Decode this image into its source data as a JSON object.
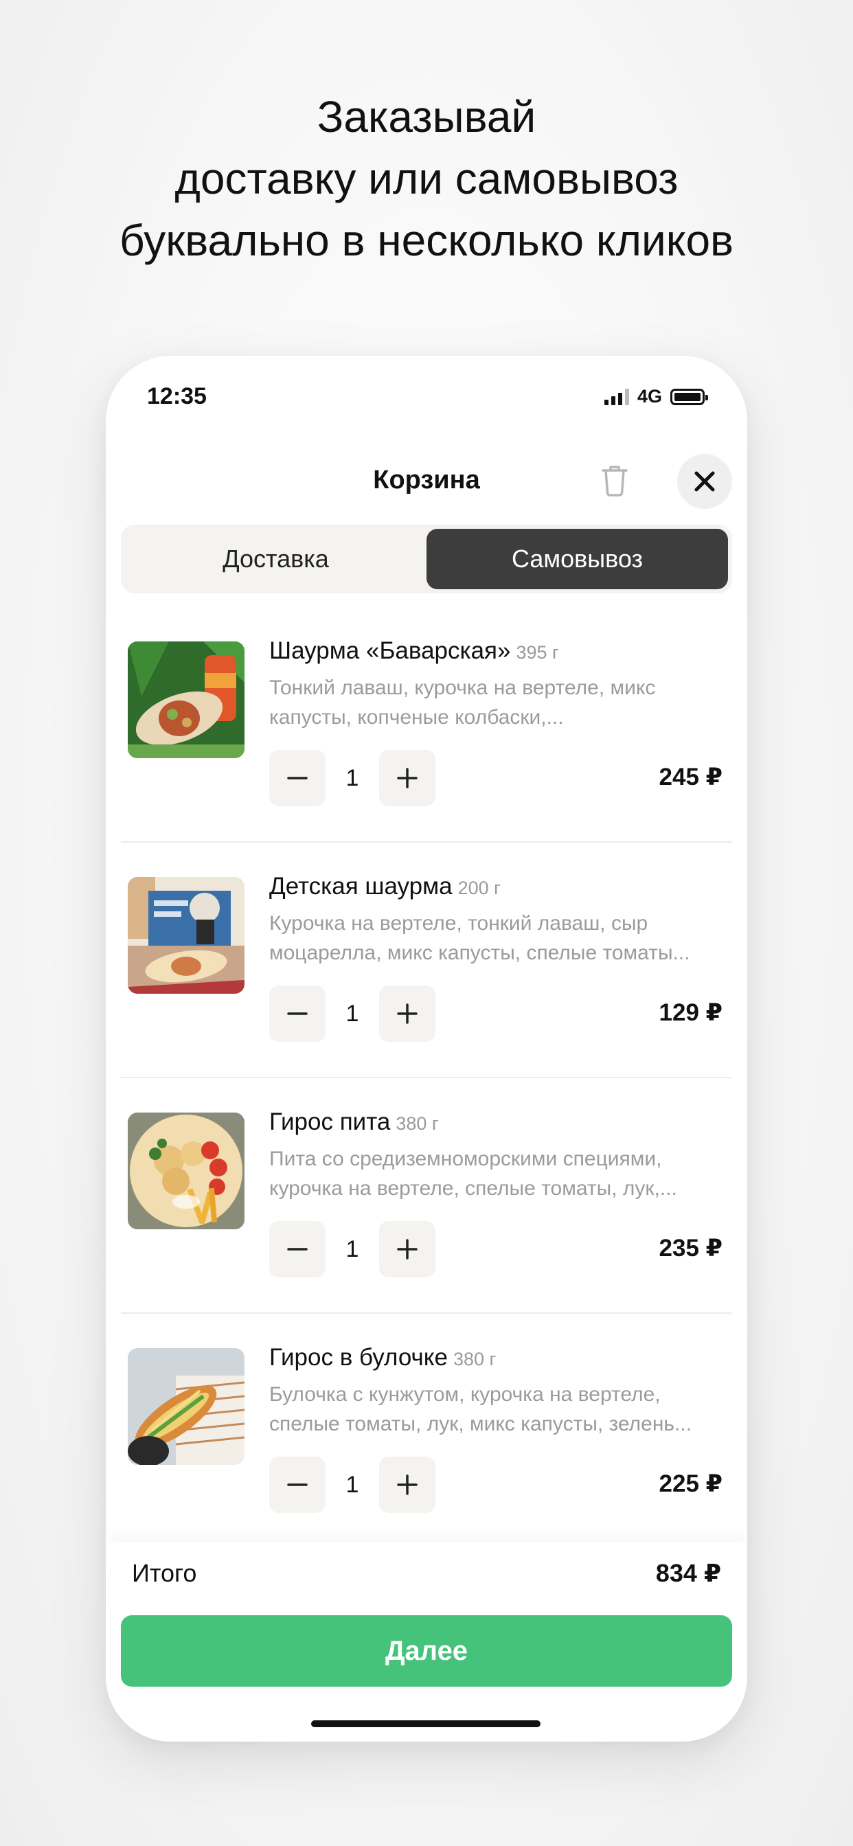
{
  "headline": [
    "Заказывай",
    "доставку или самовывоз",
    "буквально в несколько кликов"
  ],
  "status_bar": {
    "time": "12:35",
    "network": "4G"
  },
  "header": {
    "title": "Корзина"
  },
  "tabs": [
    {
      "label": "Доставка",
      "active": false
    },
    {
      "label": "Самовывоз",
      "active": true
    }
  ],
  "items": [
    {
      "name": "Шаурма «Баварская»",
      "weight": "395 г",
      "desc1": "Тонкий лаваш, курочка на вертеле, микс",
      "desc2": "капусты, копченые колбаски,...",
      "qty": "1",
      "price": "245 ₽"
    },
    {
      "name": "Детская шаурма",
      "weight": "200 г",
      "desc1": "Курочка на вертеле, тонкий лаваш, сыр",
      "desc2": "моцарелла, микс капусты, спелые томаты...",
      "qty": "1",
      "price": "129 ₽"
    },
    {
      "name": "Гирос пита",
      "weight": "380 г",
      "desc1": "Пита со средиземноморскими специями,",
      "desc2": "курочка на вертеле, спелые томаты, лук,...",
      "qty": "1",
      "price": "235 ₽"
    },
    {
      "name": "Гирос в булочке",
      "weight": "380 г",
      "desc1": "Булочка с кунжутом, курочка на вертеле,",
      "desc2": "спелые томаты, лук, микс капусты, зелень...",
      "qty": "1",
      "price": "225 ₽"
    }
  ],
  "footer": {
    "total_label": "Итого",
    "total_value": "834 ₽",
    "next_label": "Далее"
  },
  "colors": {
    "accent_green": "#45c37a",
    "active_tab": "#3d3d3d",
    "control_bg": "#f4f3ef"
  }
}
